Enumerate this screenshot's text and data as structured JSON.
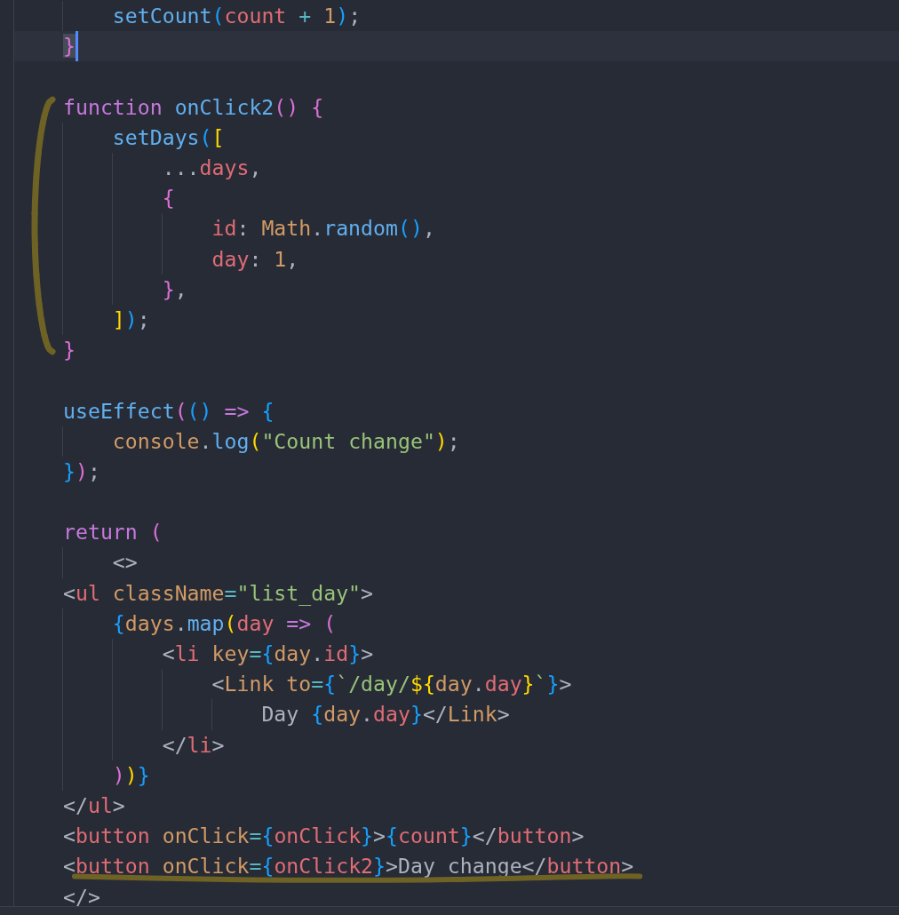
{
  "lines": [
    {
      "current": false,
      "tokens": [
        {
          "text": "    setCount",
          "kind": "function"
        },
        {
          "text": "(",
          "kind": "bracket3"
        },
        {
          "text": "count ",
          "kind": "variable"
        },
        {
          "text": "+ ",
          "kind": "operator"
        },
        {
          "text": "1",
          "kind": "number"
        },
        {
          "text": ")",
          "kind": "bracket3"
        },
        {
          "text": ";",
          "kind": "punctuation"
        }
      ]
    },
    {
      "current": true,
      "tokens": [
        {
          "text": "}",
          "kind": "bracket2"
        }
      ]
    },
    {
      "current": false
    },
    {
      "current": false,
      "bracketed": true,
      "tokens": [
        {
          "text": "function ",
          "kind": "keyword"
        },
        {
          "text": "onClick2",
          "kind": "function"
        },
        {
          "text": "() {",
          "kind": "bracket2"
        }
      ]
    },
    {
      "current": false,
      "bracketed": true,
      "tokens": [
        {
          "text": "    setDays",
          "kind": "function"
        },
        {
          "text": "(",
          "kind": "bracket3"
        },
        {
          "text": "[",
          "kind": "bracket1"
        }
      ]
    },
    {
      "current": false,
      "bracketed": true,
      "tokens": [
        {
          "text": "        ...",
          "kind": "punctuation"
        },
        {
          "text": "days",
          "kind": "variable"
        },
        {
          "text": ",",
          "kind": "punctuation"
        }
      ]
    },
    {
      "current": false,
      "bracketed": true,
      "tokens": [
        {
          "text": "        {",
          "kind": "bracket2"
        }
      ]
    },
    {
      "current": false,
      "bracketed": true,
      "tokens": [
        {
          "text": "            id",
          "kind": "variable"
        },
        {
          "text": ": ",
          "kind": "punctuation"
        },
        {
          "text": "Math",
          "kind": "property"
        },
        {
          "text": ".",
          "kind": "punctuation"
        },
        {
          "text": "random",
          "kind": "function"
        },
        {
          "text": "()",
          "kind": "bracket3"
        },
        {
          "text": ",",
          "kind": "punctuation"
        }
      ]
    },
    {
      "current": false,
      "bracketed": true,
      "tokens": [
        {
          "text": "            day",
          "kind": "variable"
        },
        {
          "text": ": ",
          "kind": "punctuation"
        },
        {
          "text": "1",
          "kind": "number"
        },
        {
          "text": ",",
          "kind": "punctuation"
        }
      ]
    },
    {
      "current": false,
      "bracketed": true,
      "tokens": [
        {
          "text": "        }",
          "kind": "bracket2"
        },
        {
          "text": ",",
          "kind": "punctuation"
        }
      ]
    },
    {
      "current": false,
      "bracketed": true,
      "tokens": [
        {
          "text": "    ]",
          "kind": "bracket1"
        },
        {
          "text": ")",
          "kind": "bracket3"
        },
        {
          "text": ";",
          "kind": "punctuation"
        }
      ]
    },
    {
      "current": false,
      "bracketed": true,
      "tokens": [
        {
          "text": "}",
          "kind": "bracket2"
        }
      ]
    },
    {
      "current": false
    },
    {
      "current": false,
      "tokens": [
        {
          "text": "useEffect",
          "kind": "function"
        },
        {
          "text": "(",
          "kind": "bracket2"
        },
        {
          "text": "() ",
          "kind": "bracket3"
        },
        {
          "text": "=> ",
          "kind": "keyword"
        },
        {
          "text": "{",
          "kind": "bracket3"
        }
      ]
    },
    {
      "current": false,
      "tokens": [
        {
          "text": "    console",
          "kind": "property"
        },
        {
          "text": ".",
          "kind": "punctuation"
        },
        {
          "text": "log",
          "kind": "function"
        },
        {
          "text": "(",
          "kind": "bracket1"
        },
        {
          "text": "\"Count change\"",
          "kind": "string"
        },
        {
          "text": ")",
          "kind": "bracket1"
        },
        {
          "text": ";",
          "kind": "punctuation"
        }
      ]
    },
    {
      "current": false,
      "tokens": [
        {
          "text": "}",
          "kind": "bracket3"
        },
        {
          "text": ")",
          "kind": "bracket2"
        },
        {
          "text": ";",
          "kind": "punctuation"
        }
      ]
    },
    {
      "current": false
    },
    {
      "current": false,
      "tokens": [
        {
          "text": "return ",
          "kind": "keyword"
        },
        {
          "text": "(",
          "kind": "bracket2"
        }
      ]
    },
    {
      "current": false,
      "tokens": [
        {
          "text": "    <>",
          "kind": "punctuation"
        }
      ]
    },
    {
      "current": false,
      "tokens": [
        {
          "text": "<",
          "kind": "punctuation"
        },
        {
          "text": "ul ",
          "kind": "variable"
        },
        {
          "text": "className",
          "kind": "property"
        },
        {
          "text": "=",
          "kind": "operator"
        },
        {
          "text": "\"list_day\"",
          "kind": "string"
        },
        {
          "text": ">",
          "kind": "punctuation"
        }
      ]
    },
    {
      "current": false,
      "tokens": [
        {
          "text": "    {",
          "kind": "bracket3"
        },
        {
          "text": "days",
          "kind": "property"
        },
        {
          "text": ".",
          "kind": "punctuation"
        },
        {
          "text": "map",
          "kind": "function"
        },
        {
          "text": "(",
          "kind": "bracket1"
        },
        {
          "text": "day ",
          "kind": "variable"
        },
        {
          "text": "=> ",
          "kind": "keyword"
        },
        {
          "text": "(",
          "kind": "bracket2"
        }
      ]
    },
    {
      "current": false,
      "tokens": [
        {
          "text": "        <",
          "kind": "punctuation"
        },
        {
          "text": "li ",
          "kind": "variable"
        },
        {
          "text": "key",
          "kind": "property"
        },
        {
          "text": "=",
          "kind": "operator"
        },
        {
          "text": "{",
          "kind": "bracket3"
        },
        {
          "text": "day",
          "kind": "property"
        },
        {
          "text": ".",
          "kind": "punctuation"
        },
        {
          "text": "id",
          "kind": "variable"
        },
        {
          "text": "}",
          "kind": "bracket3"
        },
        {
          "text": ">",
          "kind": "punctuation"
        }
      ]
    },
    {
      "current": false,
      "tokens": [
        {
          "text": "            <",
          "kind": "punctuation"
        },
        {
          "text": "Link to",
          "kind": "property"
        },
        {
          "text": "=",
          "kind": "operator"
        },
        {
          "text": "{",
          "kind": "bracket3"
        },
        {
          "text": "`/day/",
          "kind": "string"
        },
        {
          "text": "${",
          "kind": "bracket1"
        },
        {
          "text": "day",
          "kind": "property"
        },
        {
          "text": ".",
          "kind": "punctuation"
        },
        {
          "text": "day",
          "kind": "variable"
        },
        {
          "text": "}",
          "kind": "bracket1"
        },
        {
          "text": "`",
          "kind": "string"
        },
        {
          "text": "}",
          "kind": "bracket3"
        },
        {
          "text": ">",
          "kind": "punctuation"
        }
      ]
    },
    {
      "current": false,
      "tokens": [
        {
          "text": "                Day ",
          "kind": "text"
        },
        {
          "text": "{",
          "kind": "bracket3"
        },
        {
          "text": "day",
          "kind": "property"
        },
        {
          "text": ".",
          "kind": "punctuation"
        },
        {
          "text": "day",
          "kind": "variable"
        },
        {
          "text": "}",
          "kind": "bracket3"
        },
        {
          "text": "</",
          "kind": "punctuation"
        },
        {
          "text": "Link",
          "kind": "property"
        },
        {
          "text": ">",
          "kind": "punctuation"
        }
      ]
    },
    {
      "current": false,
      "tokens": [
        {
          "text": "        </",
          "kind": "punctuation"
        },
        {
          "text": "li",
          "kind": "variable"
        },
        {
          "text": ">",
          "kind": "punctuation"
        }
      ]
    },
    {
      "current": false,
      "tokens": [
        {
          "text": "    )",
          "kind": "bracket2"
        },
        {
          "text": ")",
          "kind": "bracket1"
        },
        {
          "text": "}",
          "kind": "bracket3"
        }
      ]
    },
    {
      "current": false,
      "tokens": [
        {
          "text": "</",
          "kind": "punctuation"
        },
        {
          "text": "ul",
          "kind": "variable"
        },
        {
          "text": ">",
          "kind": "punctuation"
        }
      ]
    },
    {
      "current": false,
      "tokens": [
        {
          "text": "<",
          "kind": "punctuation"
        },
        {
          "text": "button ",
          "kind": "variable"
        },
        {
          "text": "onClick",
          "kind": "property"
        },
        {
          "text": "=",
          "kind": "operator"
        },
        {
          "text": "{",
          "kind": "bracket3"
        },
        {
          "text": "onClick",
          "kind": "variable"
        },
        {
          "text": "}",
          "kind": "bracket3"
        },
        {
          "text": ">",
          "kind": "punctuation"
        },
        {
          "text": "{",
          "kind": "bracket3"
        },
        {
          "text": "count",
          "kind": "variable"
        },
        {
          "text": "}",
          "kind": "bracket3"
        },
        {
          "text": "</",
          "kind": "punctuation"
        },
        {
          "text": "button",
          "kind": "variable"
        },
        {
          "text": ">",
          "kind": "punctuation"
        }
      ]
    },
    {
      "current": false,
      "underlined": true,
      "tokens": [
        {
          "text": "<",
          "kind": "punctuation"
        },
        {
          "text": "button ",
          "kind": "variable"
        },
        {
          "text": "onClick",
          "kind": "property"
        },
        {
          "text": "=",
          "kind": "operator"
        },
        {
          "text": "{",
          "kind": "bracket3"
        },
        {
          "text": "onClick2",
          "kind": "variable"
        },
        {
          "text": "}",
          "kind": "bracket3"
        },
        {
          "text": ">Day change</",
          "kind": "punctuation"
        },
        {
          "text": "button",
          "kind": "variable"
        },
        {
          "text": ">",
          "kind": "punctuation"
        }
      ]
    },
    {
      "current": false,
      "tokens": [
        {
          "text": "</>",
          "kind": "punctuation"
        }
      ]
    }
  ]
}
